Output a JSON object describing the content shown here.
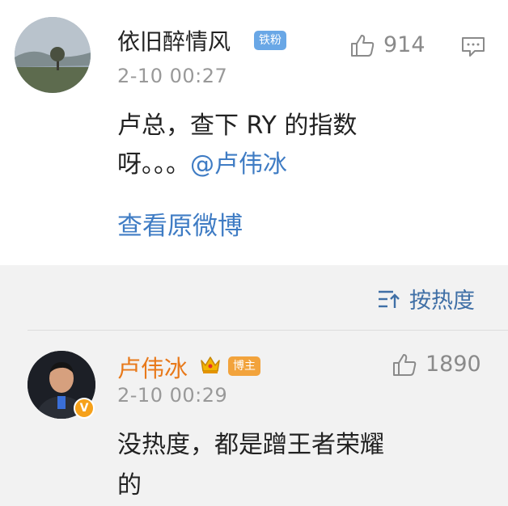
{
  "post": {
    "user_name": "依旧醉情风",
    "fan_badge": "铁粉",
    "time": "2-10 00:27",
    "like_count": "914",
    "text_line1": "卢总，查下 RY 的指数",
    "text_line2_prefix": "呀。。。",
    "mention": "@卢伟冰",
    "view_original": "查看原微博"
  },
  "comments_header": {
    "sort_label": "按热度"
  },
  "reply": {
    "user_name": "卢伟冰",
    "host_badge": "博主",
    "verified_badge": "V",
    "time": "2-10 00:29",
    "like_count": "1890",
    "text_line1": "没热度，都是蹭王者荣耀",
    "text_line2": "的"
  },
  "colors": {
    "link": "#3f7cc4",
    "reply_name": "#e8791a",
    "fan_badge": "#69a7e6",
    "host_badge": "#f2a33c",
    "secondary_text": "#999999"
  },
  "icons": [
    "thumbs-up-icon",
    "comment-icon",
    "sort-icon",
    "crown-icon",
    "verified-icon"
  ]
}
